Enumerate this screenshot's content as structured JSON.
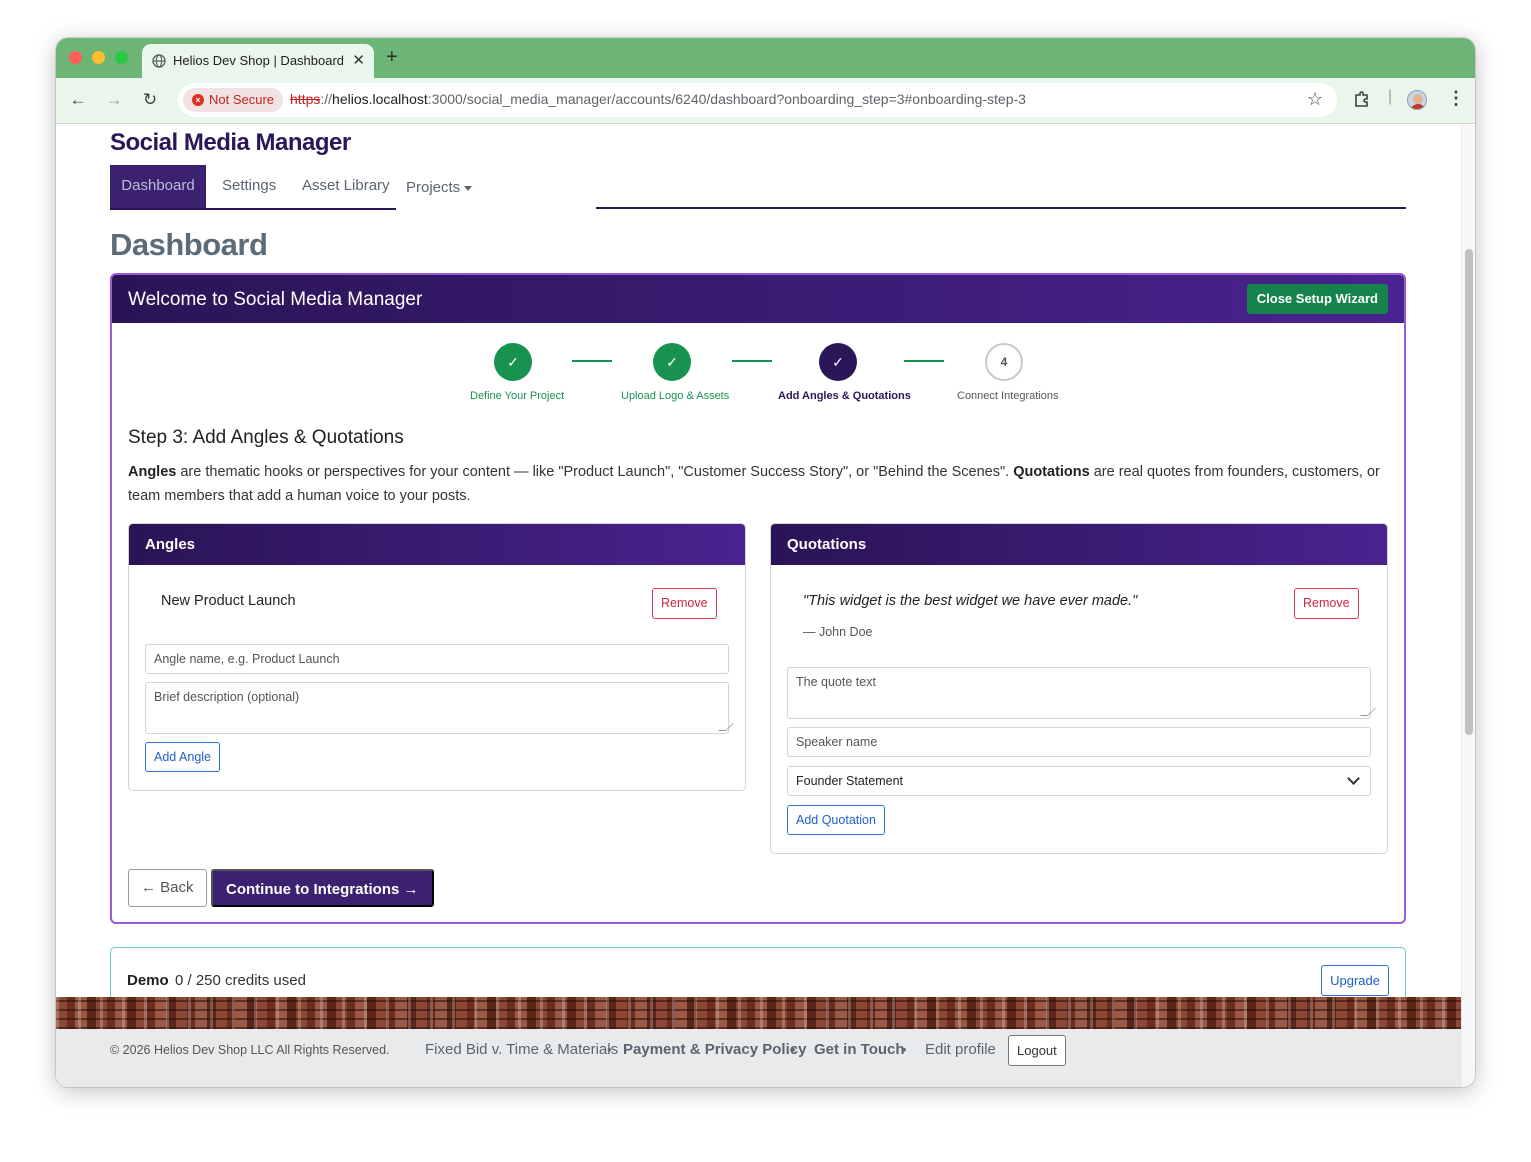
{
  "browser": {
    "tab_title": "Helios Dev Shop | Dashboard",
    "security_label": "Not Secure",
    "url_scheme": "https",
    "url_separator": "://",
    "url_host": "helios.localhost",
    "url_rest": ":3000/social_media_manager/accounts/6240/dashboard?onboarding_step=3#onboarding-step-3"
  },
  "header": {
    "brand": "Social Media Manager",
    "nav": {
      "dashboard": "Dashboard",
      "settings": "Settings",
      "asset_library": "Asset Library",
      "projects": "Projects"
    }
  },
  "page_title": "Dashboard",
  "wizard": {
    "title": "Welcome to Social Media Manager",
    "close_label": "Close Setup Wizard",
    "steps": [
      {
        "number": "1",
        "label": "Define Your Project",
        "state": "done"
      },
      {
        "number": "2",
        "label": "Upload Logo & Assets",
        "state": "done"
      },
      {
        "number": "3",
        "label": "Add Angles & Quotations",
        "state": "current"
      },
      {
        "number": "4",
        "label": "Connect Integrations",
        "state": "todo"
      }
    ],
    "step_heading": "Step 3: Add Angles & Quotations",
    "desc": {
      "angles_term": "Angles",
      "angles_text": " are thematic hooks or perspectives for your content — like \"Product Launch\", \"Customer Success Story\", or \"Behind the Scenes\". ",
      "quotations_term": "Quotations",
      "quotations_text": " are real quotes from founders, customers, or team members that add a human voice to your posts."
    },
    "angles": {
      "header": "Angles",
      "items": [
        {
          "name": "New Product Launch",
          "remove_label": "Remove"
        }
      ],
      "name_placeholder": "Angle name, e.g. Product Launch",
      "description_placeholder": "Brief description (optional)",
      "add_label": "Add Angle"
    },
    "quotations": {
      "header": "Quotations",
      "items": [
        {
          "text": "\"This widget is the best widget we have ever made.\"",
          "speaker": "— John Doe",
          "remove_label": "Remove"
        }
      ],
      "text_placeholder": "The quote text",
      "speaker_placeholder": "Speaker name",
      "type_selected": "Founder Statement",
      "add_label": "Add Quotation"
    },
    "back_label": "← Back",
    "continue_label": "Continue to Integrations →"
  },
  "credits": {
    "plan": "Demo",
    "used": "0 / 250 credits used",
    "upgrade_label": "Upgrade"
  },
  "footer": {
    "copyright": "© 2026 Helios Dev Shop LLC All Rights Reserved.",
    "links": [
      "Fixed Bid v. Time & Materials",
      "Payment & Privacy Policy",
      "Get in Touch",
      "Edit profile"
    ],
    "separator": "•",
    "logout_label": "Logout"
  },
  "colors": {
    "brand_purple": "#2b1657",
    "success_green": "#18924f",
    "danger_red": "#c9283c",
    "link_blue": "#1f5fc7",
    "browser_frame": "#6db577"
  }
}
